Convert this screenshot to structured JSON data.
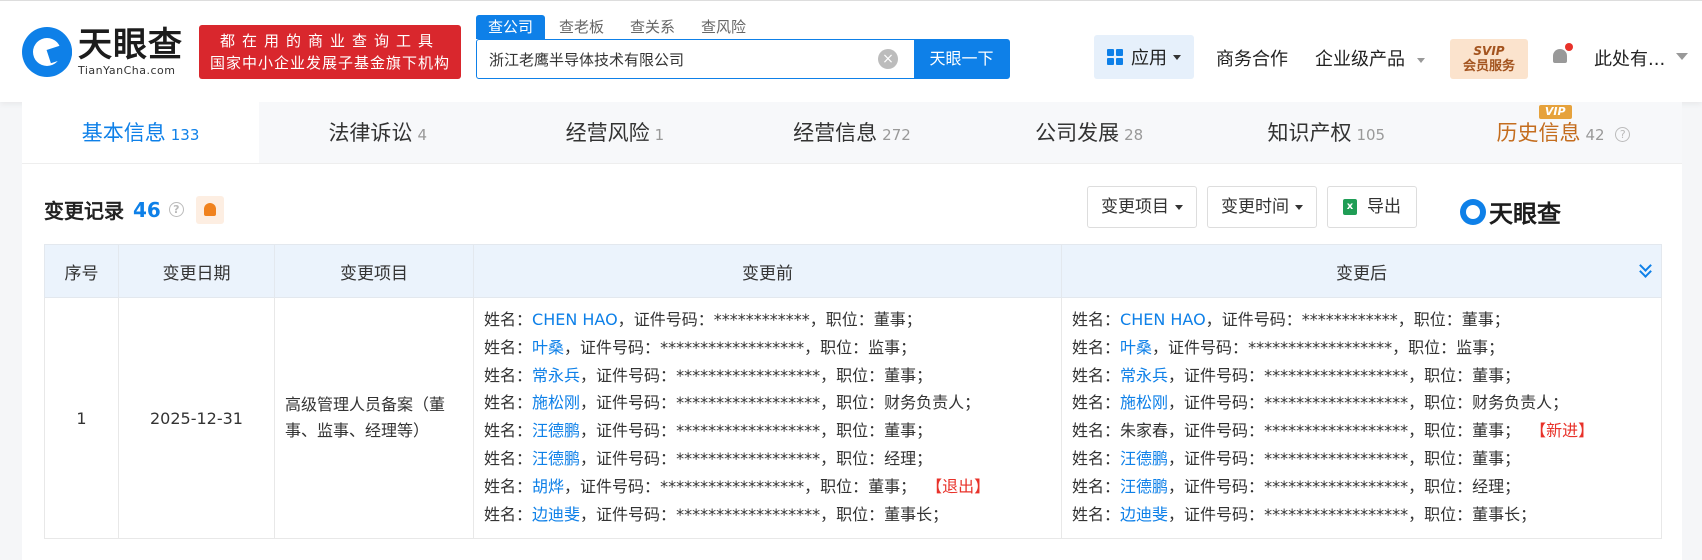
{
  "header": {
    "logo_cn": "天眼查",
    "logo_en": "TianYanCha.com",
    "slogan_line1": "都在用的商业查询工具",
    "slogan_line2": "国家中小企业发展子基金旗下机构",
    "search_tabs": [
      "查公司",
      "查老板",
      "查关系",
      "查风险"
    ],
    "search_value": "浙江老鹰半导体技术有限公司",
    "search_button": "天眼一下",
    "apps_label": "应用",
    "business_link": "商务合作",
    "enterprise_link": "企业级产品",
    "vip_line1": "SVIP",
    "vip_line2": "会员服务",
    "user_name": "此处有..."
  },
  "tabs": [
    {
      "label": "基本信息",
      "count": "133"
    },
    {
      "label": "法律诉讼",
      "count": "4"
    },
    {
      "label": "经营风险",
      "count": "1"
    },
    {
      "label": "经营信息",
      "count": "272"
    },
    {
      "label": "公司发展",
      "count": "28"
    },
    {
      "label": "知识产权",
      "count": "105"
    },
    {
      "label": "历史信息",
      "count": "42",
      "badge": "VIP"
    }
  ],
  "section": {
    "title": "变更记录",
    "count": "46",
    "filter_item": "变更项目",
    "filter_time": "变更时间",
    "export": "导出",
    "brand": "天眼查"
  },
  "table": {
    "headers": [
      "序号",
      "变更日期",
      "变更项目",
      "变更前",
      "变更后"
    ],
    "row": {
      "index": "1",
      "date": "2025-12-31",
      "item": "高级管理人员备案（董事、监事、经理等）",
      "labels": {
        "name": "姓名：",
        "id": "证件号码：",
        "position": "职位："
      },
      "before": [
        {
          "name": "CHEN HAO",
          "id": "************",
          "position": "董事",
          "linked": true
        },
        {
          "name": "叶桑",
          "id": "******************",
          "position": "监事",
          "linked": true
        },
        {
          "name": "常永兵",
          "id": "******************",
          "position": "董事",
          "linked": true
        },
        {
          "name": "施松刚",
          "id": "******************",
          "position": "财务负责人",
          "linked": true
        },
        {
          "name": "汪德鹏",
          "id": "******************",
          "position": "董事",
          "linked": true
        },
        {
          "name": "汪德鹏",
          "id": "******************",
          "position": "经理",
          "linked": true
        },
        {
          "name": "胡烨",
          "id": "******************",
          "position": "董事",
          "linked": true,
          "tag": "【退出】"
        },
        {
          "name": "边迪斐",
          "id": "******************",
          "position": "董事长",
          "linked": true
        }
      ],
      "after": [
        {
          "name": "CHEN HAO",
          "id": "************",
          "position": "董事",
          "linked": true
        },
        {
          "name": "叶桑",
          "id": "******************",
          "position": "监事",
          "linked": true
        },
        {
          "name": "常永兵",
          "id": "******************",
          "position": "董事",
          "linked": true
        },
        {
          "name": "施松刚",
          "id": "******************",
          "position": "财务负责人",
          "linked": true
        },
        {
          "name": "朱家春",
          "id": "******************",
          "position": "董事",
          "linked": false,
          "tag": "【新进】"
        },
        {
          "name": "汪德鹏",
          "id": "******************",
          "position": "董事",
          "linked": true
        },
        {
          "name": "汪德鹏",
          "id": "******************",
          "position": "经理",
          "linked": true
        },
        {
          "name": "边迪斐",
          "id": "******************",
          "position": "董事长",
          "linked": true
        }
      ]
    }
  },
  "colors": {
    "accent": "#0e80e8",
    "slogan_bg": "#d9272d",
    "history_tab": "#c46d1e",
    "tag_red": "#e8322a"
  }
}
